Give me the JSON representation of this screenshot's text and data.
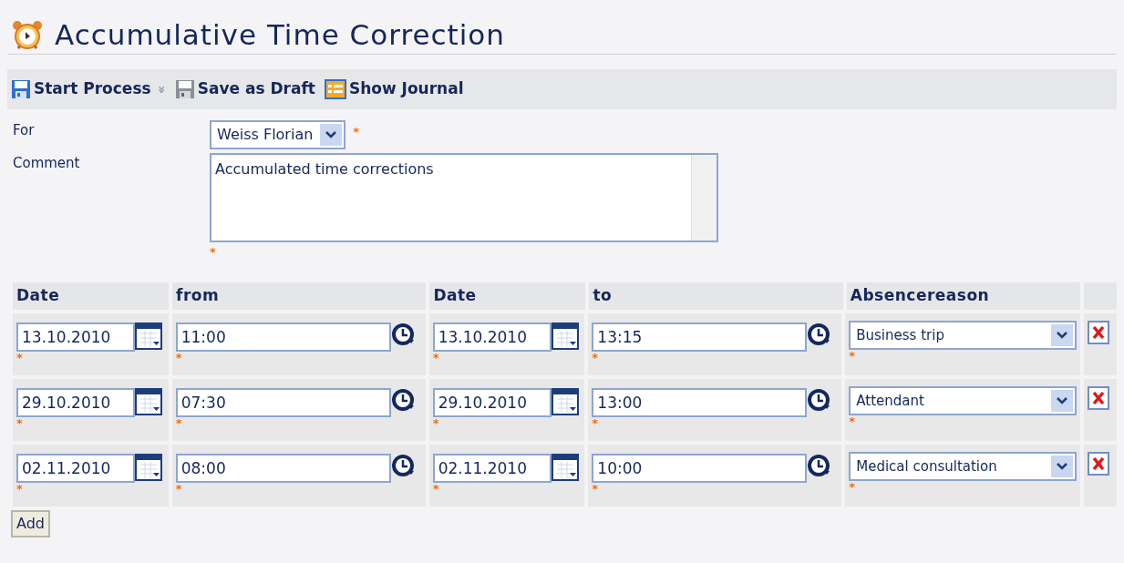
{
  "title": "Accumulative Time Correction",
  "toolbar": [
    {
      "kind": "start",
      "label": "Start Process",
      "caret": "»"
    },
    {
      "kind": "draft",
      "label": "Save as Draft"
    },
    {
      "kind": "journal",
      "label": "Show Journal"
    }
  ],
  "form": {
    "for": {
      "label": "For",
      "value": "Weiss Florian",
      "required": "*"
    },
    "comment": {
      "label": "Comment",
      "value": "Accumulated time corrections",
      "required": "*"
    }
  },
  "table": {
    "columns": [
      "Date",
      "from",
      "Date",
      "to",
      "Absencereason"
    ],
    "rows": [
      {
        "date_from": "13.10.2010",
        "from": "11:00",
        "date_to": "13.10.2010",
        "to": "13:15",
        "reason": "Business trip",
        "required": "*"
      },
      {
        "date_from": "29.10.2010",
        "from": "07:30",
        "date_to": "29.10.2010",
        "to": "13:00",
        "reason": "Attendant",
        "required": "*"
      },
      {
        "date_from": "02.11.2010",
        "from": "08:00",
        "date_to": "02.11.2010",
        "to": "10:00",
        "reason": "Medical consultation",
        "required": "*"
      }
    ]
  },
  "add_button": "Add"
}
